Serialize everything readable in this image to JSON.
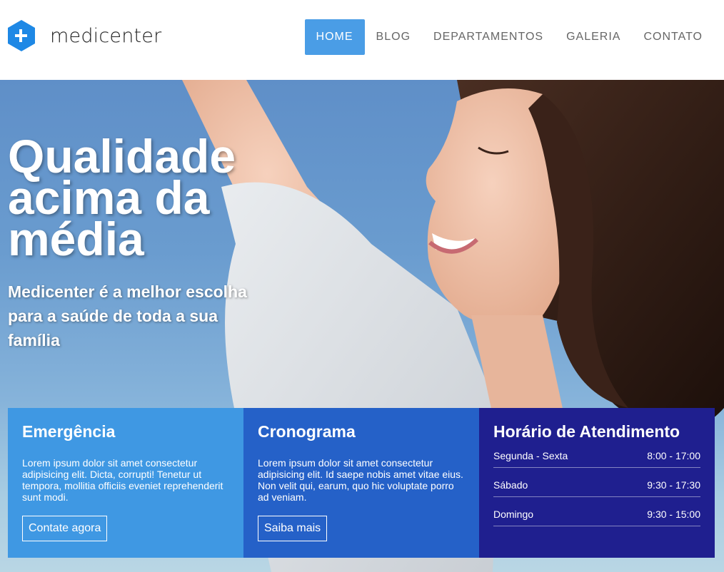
{
  "brand": {
    "name": "medicenter",
    "logo_icon": "medical-cross-hexagon",
    "color": "#1e88e5"
  },
  "nav": {
    "items": [
      {
        "label": "HOME",
        "active": true
      },
      {
        "label": "BLOG",
        "active": false
      },
      {
        "label": "DEPARTAMENTOS",
        "active": false
      },
      {
        "label": "GALERIA",
        "active": false
      },
      {
        "label": "CONTATO",
        "active": false
      }
    ],
    "active_color": "#4a9de6"
  },
  "hero": {
    "title_lines": [
      "Qualidade",
      "acima da",
      "média"
    ],
    "subtitle": "Medicenter é a melhor escolha para a saúde de toda a sua família"
  },
  "boxes": {
    "emergency": {
      "title": "Emergência",
      "text": "Lorem ipsum dolor sit amet consectetur adipisicing elit. Dicta, corrupti! Tenetur ut tempora, mollitia officiis eveniet reprehenderit sunt modi.",
      "button": "Contate agora",
      "color": "#3f98e3"
    },
    "schedule": {
      "title": "Cronograma",
      "text": "Lorem ipsum dolor sit amet consectetur adipisicing elit. Id saepe nobis amet vitae eius. Non velit qui, earum, quo hic voluptate porro ad veniam.",
      "button": "Saiba mais",
      "color": "#2561c8"
    },
    "hours": {
      "title": "Horário de Atendimento",
      "rows": [
        {
          "day": "Segunda - Sexta",
          "time": "8:00 - 17:00"
        },
        {
          "day": "Sábado",
          "time": "9:30 - 17:30"
        },
        {
          "day": "Domingo",
          "time": "9:30 - 15:00"
        }
      ],
      "color": "#1f1f8f"
    }
  }
}
